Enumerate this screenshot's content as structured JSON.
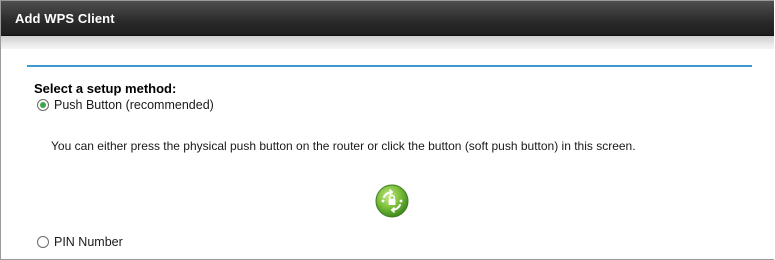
{
  "header": {
    "title": "Add WPS Client"
  },
  "form": {
    "section_label": "Select a setup method:",
    "options": [
      {
        "label": "Push Button (recommended)",
        "selected": true,
        "description": "You can either press the physical push button on the router or click the button (soft push button) in this screen."
      },
      {
        "label": "PIN Number",
        "selected": false
      }
    ],
    "wps_icon": "wps-push-button-icon"
  },
  "colors": {
    "title_bar": "#2a2a2a",
    "rule": "#3e98d0",
    "wps_green": "#7cbf3a",
    "radio_selected": "#3aa84a"
  }
}
